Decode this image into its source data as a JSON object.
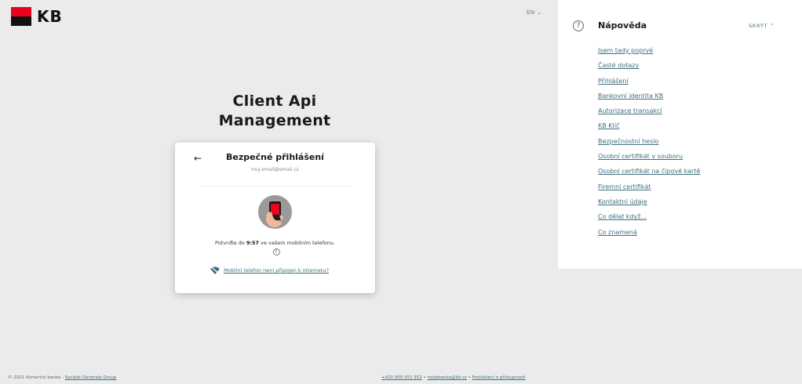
{
  "brand": {
    "logo_text": "KB",
    "red": "#e9041e",
    "dark": "#111111",
    "accent": "#3d6f7f"
  },
  "language": {
    "current": "EN",
    "chevron": "⌄"
  },
  "app_title_line1": "Client Api",
  "app_title_line2": "Management",
  "card": {
    "back_icon": "arrow-left-icon",
    "title": "Bezpečné přihlášení",
    "email": "muj.email@email.cz",
    "illustration": "phone-in-hand-icon",
    "confirm_prefix": "Potvrďte do ",
    "confirm_time": "9:57",
    "confirm_suffix": " ve vašem mobilním telefonu.",
    "help_icon_glyph": "?",
    "offline_link": "Mobilní telefon není připojen k internetu?"
  },
  "help": {
    "icon_glyph": "?",
    "title": "Nápověda",
    "hide_label": "SKRÝT ⌃",
    "links": [
      "Jsem tady poprvé",
      "Časté dotazy",
      "Přihlášení",
      "Bankovní identita KB",
      "Autorizace transakcí",
      "KB Klíč",
      "Bezpečnostní heslo",
      "Osobní certifikát v souboru",
      "Osobní certifikát na čipové kartě",
      "Firemní certifikát",
      "Kontaktní údaje",
      "Co dělat když...",
      "Co znamená"
    ]
  },
  "footer": {
    "copyright": "© 2021 Komerční banka - ",
    "group_link": "Société Générale Group",
    "phone_link": "+420 955 551 552",
    "sep1": " • ",
    "email_link": "mojebanka@kb.cz",
    "sep2": " • ",
    "access_link": "Prohlášení o přístupnosti"
  }
}
